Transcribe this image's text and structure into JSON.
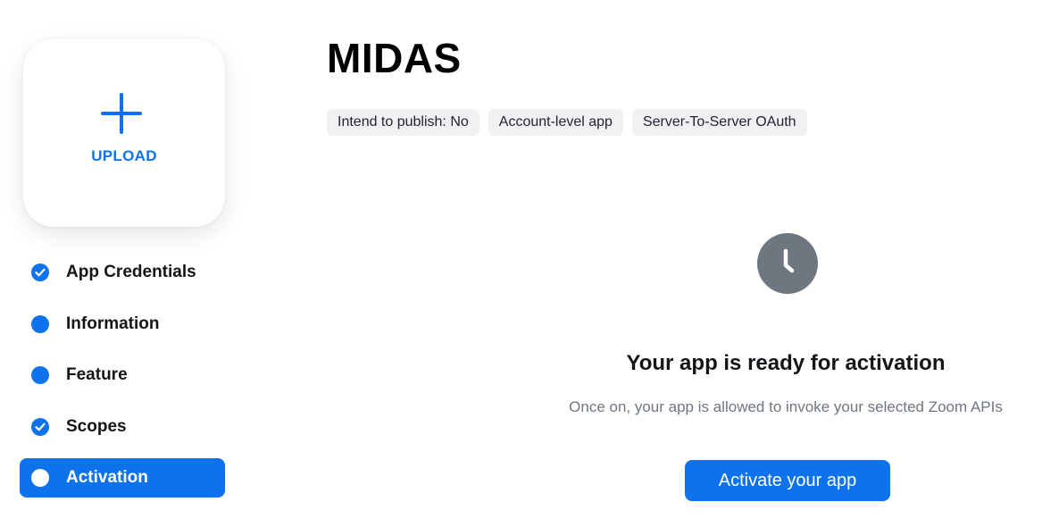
{
  "upload": {
    "label": "UPLOAD",
    "icon": "plus-icon"
  },
  "sidebar": {
    "items": [
      {
        "label": "App Credentials",
        "icon": "check-circle-icon",
        "state": "complete"
      },
      {
        "label": "Information",
        "icon": "dot-icon",
        "state": "pending"
      },
      {
        "label": "Feature",
        "icon": "dot-icon",
        "state": "pending"
      },
      {
        "label": "Scopes",
        "icon": "check-circle-icon",
        "state": "complete"
      },
      {
        "label": "Activation",
        "icon": "dot-icon",
        "state": "active"
      }
    ]
  },
  "app": {
    "title": "MIDAS",
    "badges": [
      "Intend to publish: No",
      "Account-level app",
      "Server-To-Server OAuth"
    ]
  },
  "main": {
    "status_icon": "clock-icon",
    "heading": "Your app is ready for activation",
    "subtext": "Once on, your app is allowed to invoke your selected Zoom APIs",
    "activate_label": "Activate your app"
  },
  "colors": {
    "accent": "#0e72ed",
    "clock": "#6e7680",
    "badge_bg": "#f1f1f4"
  }
}
